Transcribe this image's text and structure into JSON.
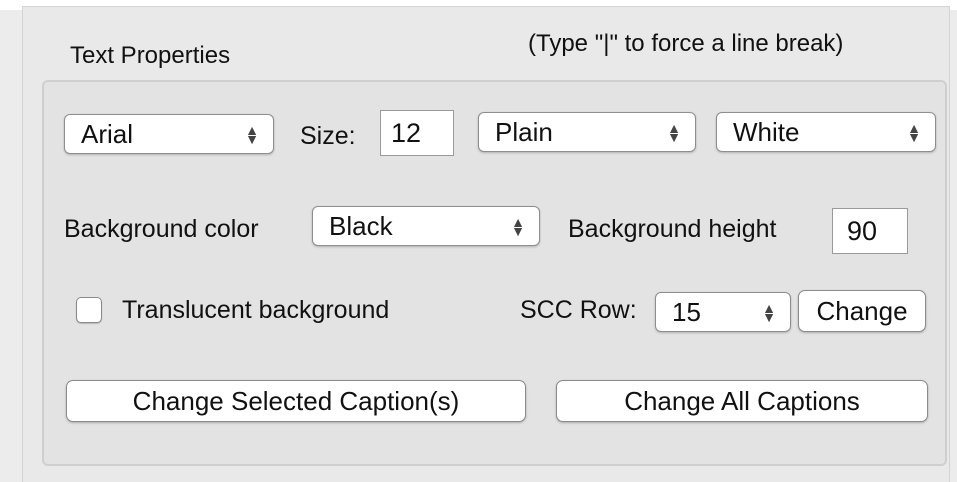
{
  "panel": {
    "title": "Text Properties",
    "hint": "(Type  \"|\" to force a line break)"
  },
  "font": {
    "family": "Arial",
    "size_label": "Size:",
    "size": "12",
    "style": "Plain",
    "color": "White"
  },
  "background": {
    "color_label": "Background color",
    "color": "Black",
    "height_label": "Background height",
    "height": "90",
    "translucent_label": "Translucent background",
    "translucent_checked": false
  },
  "scc": {
    "label": "SCC Row:",
    "row": "15",
    "change_label": "Change"
  },
  "actions": {
    "change_selected": "Change Selected Caption(s)",
    "change_all": "Change All Captions"
  },
  "icons": {
    "popup_arrows": "up-down-chevron-icon"
  }
}
